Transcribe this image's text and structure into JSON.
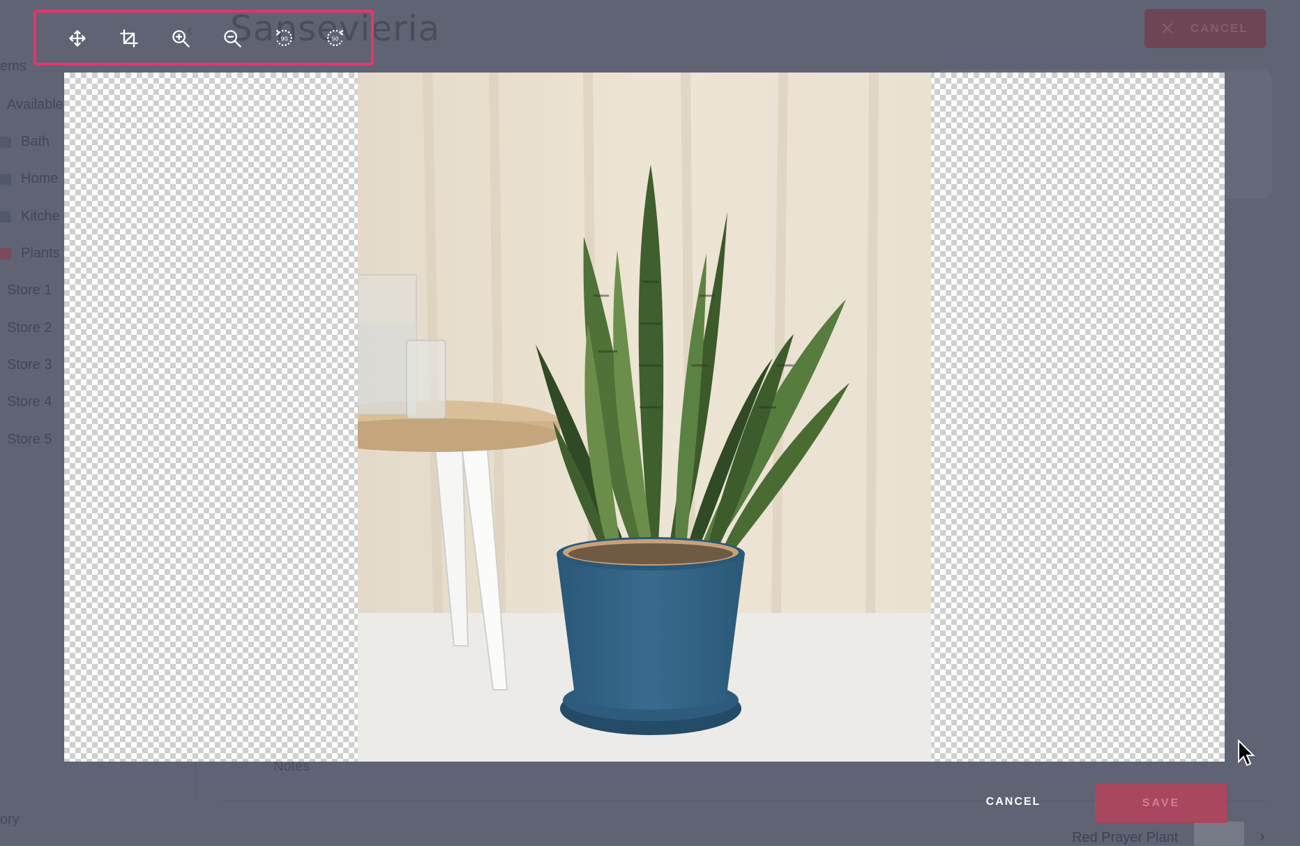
{
  "background": {
    "page_title": "Sansevieria",
    "top_cancel_label": "CANCEL",
    "sidebar": {
      "section_label": "ems",
      "available_label": "Available",
      "categories": [
        "Bath",
        "Home",
        "Kitche",
        "Plants"
      ],
      "stores": [
        "Store 1",
        "Store 2",
        "Store 3",
        "Store 4",
        "Store 5"
      ],
      "history_label": "ory"
    },
    "notes_label": "Notes",
    "list_item_label": "Red Prayer Plant"
  },
  "toolbar": {
    "tools": [
      {
        "icon": "move-icon"
      },
      {
        "icon": "crop-icon"
      },
      {
        "icon": "zoom-in-icon"
      },
      {
        "icon": "zoom-out-icon"
      },
      {
        "icon": "rotate-left-90-icon",
        "text": "90"
      },
      {
        "icon": "rotate-right-90-icon",
        "text": "90"
      }
    ],
    "highlight_color": "#e8336a"
  },
  "dialog": {
    "cancel_label": "CANCEL",
    "save_label": "SAVE",
    "save_color": "#a8475e"
  }
}
